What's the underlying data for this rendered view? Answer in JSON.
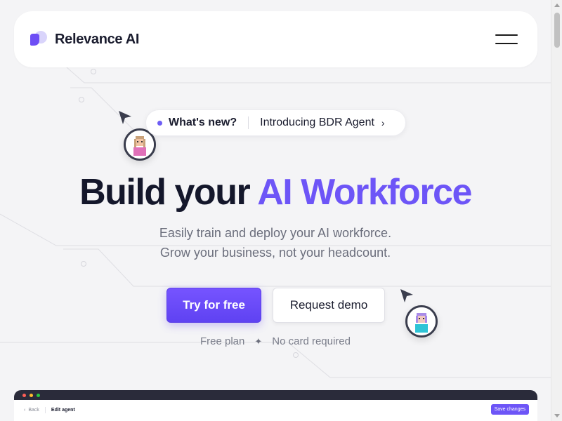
{
  "brand": {
    "name": "Relevance AI",
    "logo_icon": "relevance-logo-icon",
    "accent": "#6d55f7"
  },
  "nav": {
    "menu_icon": "hamburger-menu-icon"
  },
  "announcement": {
    "badge": "What's new?",
    "text": "Introducing BDR Agent",
    "chevron": "›"
  },
  "hero": {
    "title_plain": "Build your",
    "title_accent": "AI Workforce",
    "subtitle_line1": "Easily train and deploy your AI workforce.",
    "subtitle_line2": "Grow your business, not your headcount."
  },
  "cta": {
    "primary": "Try for free",
    "secondary": "Request demo"
  },
  "perks": {
    "left": "Free plan",
    "separator": "✦",
    "right": "No card required"
  },
  "preview": {
    "back": "Back",
    "page": "Edit agent",
    "save": "Save changes",
    "back_chevron": "‹"
  },
  "colors": {
    "primary": "#6d55f7",
    "text": "#14172b",
    "muted": "#6b6e7c",
    "background": "#f4f4f6"
  }
}
